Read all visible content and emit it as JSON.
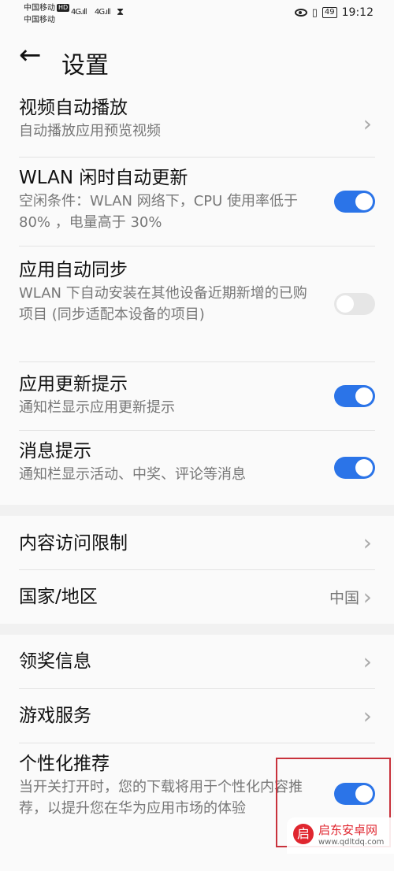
{
  "status_bar": {
    "carrier1": "中国移动",
    "hd_badge": "HD",
    "carrier2": "中国移动",
    "signal1": "4G.ıll",
    "signal2": "4G.ıll",
    "hourglass": "⧗",
    "battery": "49",
    "time": "19:12"
  },
  "header": {
    "back_glyph": "←",
    "title": "设置"
  },
  "group1": {
    "video_autoplay": {
      "title": "视频自动播放",
      "subtitle": "自动播放应用预览视频"
    },
    "wlan_update": {
      "title": "WLAN 闲时自动更新",
      "subtitle": "空闲条件：WLAN 网络下，CPU 使用率低于 80% ，电量高于 30%",
      "on": true
    },
    "auto_sync": {
      "title": "应用自动同步",
      "subtitle": "WLAN 下自动安装在其他设备近期新增的已购项目 (同步适配本设备的项目)",
      "on": false
    },
    "update_hint": {
      "title": "应用更新提示",
      "subtitle": "通知栏显示应用更新提示",
      "on": true
    },
    "message_hint": {
      "title": "消息提示",
      "subtitle": "通知栏显示活动、中奖、评论等消息",
      "on": true
    }
  },
  "group2": {
    "content_limit": {
      "title": "内容访问限制"
    },
    "region": {
      "title": "国家/地区",
      "value": "中国"
    }
  },
  "group3": {
    "prize_info": {
      "title": "领奖信息"
    },
    "game_service": {
      "title": "游戏服务"
    },
    "personalized": {
      "title": "个性化推荐",
      "subtitle": "当开关打开时，您的下载将用于个性化内容推荐，以提升您在华为应用市场的体验",
      "on": true
    }
  },
  "watermark": {
    "logo_char": "启",
    "name": "启东安卓网",
    "url": "www.qdltdq.com"
  },
  "colors": {
    "toggle_on": "#2b74e8",
    "toggle_off": "#e6e6e6",
    "highlight_box": "#c8323c"
  }
}
